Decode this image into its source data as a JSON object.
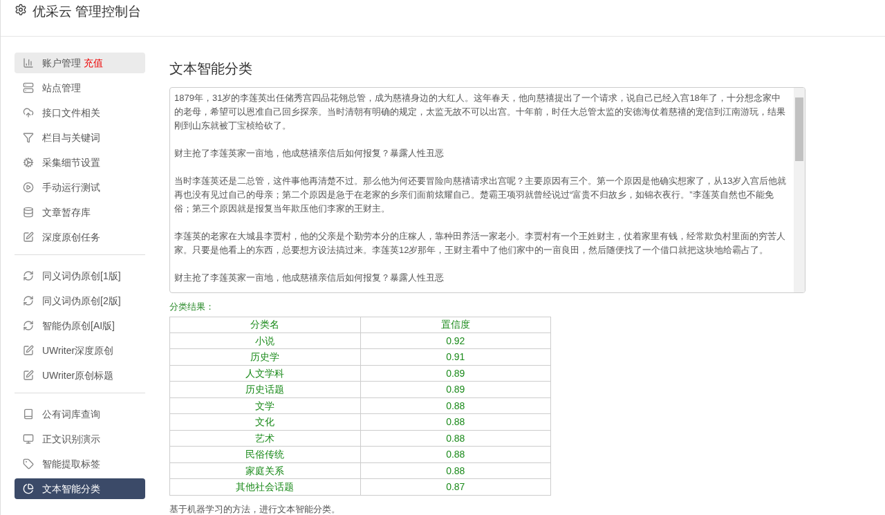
{
  "header": {
    "title": "优采云 管理控制台"
  },
  "sidebar": {
    "groups": [
      [
        {
          "label": "账户管理",
          "badge": "充值",
          "selected": false,
          "hovered": true
        },
        {
          "label": "站点管理",
          "selected": false,
          "hovered": false
        },
        {
          "label": "接口文件相关",
          "selected": false,
          "hovered": false
        },
        {
          "label": "栏目与关键词",
          "selected": false,
          "hovered": false
        },
        {
          "label": "采集细节设置",
          "selected": false,
          "hovered": false
        },
        {
          "label": "手动运行测试",
          "selected": false,
          "hovered": false
        },
        {
          "label": "文章暂存库",
          "selected": false,
          "hovered": false
        },
        {
          "label": "深度原创任务",
          "selected": false,
          "hovered": false
        }
      ],
      [
        {
          "label": "同义词伪原创[1版]",
          "selected": false,
          "hovered": false
        },
        {
          "label": "同义词伪原创[2版]",
          "selected": false,
          "hovered": false
        },
        {
          "label": "智能伪原创[AI版]",
          "selected": false,
          "hovered": false
        },
        {
          "label": "UWriter深度原创",
          "selected": false,
          "hovered": false
        },
        {
          "label": "UWriter原创标题",
          "selected": false,
          "hovered": false
        }
      ],
      [
        {
          "label": "公有词库查询",
          "selected": false,
          "hovered": false
        },
        {
          "label": "正文识别演示",
          "selected": false,
          "hovered": false
        },
        {
          "label": "智能提取标签",
          "selected": false,
          "hovered": false
        },
        {
          "label": "文本智能分类",
          "selected": true,
          "hovered": false
        }
      ]
    ]
  },
  "main": {
    "title": "文本智能分类",
    "text_area": {
      "paragraphs": [
        "1879年，31岁的李莲英出任储秀宫四品花翎总管，成为慈禧身边的大红人。这年春天，他向慈禧提出了一个请求，说自己已经入宫18年了，十分想念家中的老母，希望可以恩准自己回乡探亲。当时清朝有明确的规定，太监无故不可以出宫。十年前，时任大总管太监的安德海仗着慈禧的宠信到江南游玩，结果刚到山东就被丁宝桢给砍了。",
        "财主抢了李莲英家一亩地，他成慈禧亲信后如何报复？暴露人性丑恶",
        "当时李莲英还是二总管，这件事他再清楚不过。那么他为何还要冒险向慈禧请求出宫呢？主要原因有三个。第一个原因是他确实想家了，从13岁入宫后他就再也没有见过自己的母亲；第二个原因是急于在老家的乡亲们面前炫耀自己。楚霸王项羽就曾经说过“富贵不归故乡，如锦衣夜行。”李莲英自然也不能免俗；第三个原因就是报复当年欺压他们李家的王财主。",
        "李莲英的老家在大城县李贾村，他的父亲是个勤劳本分的庄稼人，靠种田养活一家老小。李贾村有一个王姓财主，仗着家里有钱，经常欺负村里面的穷苦人家。只要是他看上的东西，总要想方设法搞过来。李莲英12岁那年，王财主看中了他们家中的一亩良田，然后随便找了一个借口就把这块地给霸占了。",
        "财主抢了李莲英家一亩地，他成慈禧亲信后如何报复？暴露人性丑恶"
      ]
    },
    "result_label": "分类结果：",
    "table": {
      "columns": [
        "分类名",
        "置信度"
      ],
      "rows": [
        [
          "小说",
          "0.92"
        ],
        [
          "历史学",
          "0.91"
        ],
        [
          "人文学科",
          "0.89"
        ],
        [
          "历史话题",
          "0.89"
        ],
        [
          "文学",
          "0.88"
        ],
        [
          "文化",
          "0.88"
        ],
        [
          "艺术",
          "0.88"
        ],
        [
          "民俗传统",
          "0.88"
        ],
        [
          "家庭关系",
          "0.88"
        ],
        [
          "其他社会话题",
          "0.87"
        ]
      ]
    },
    "note": "基于机器学习的方法，进行文本智能分类。"
  }
}
